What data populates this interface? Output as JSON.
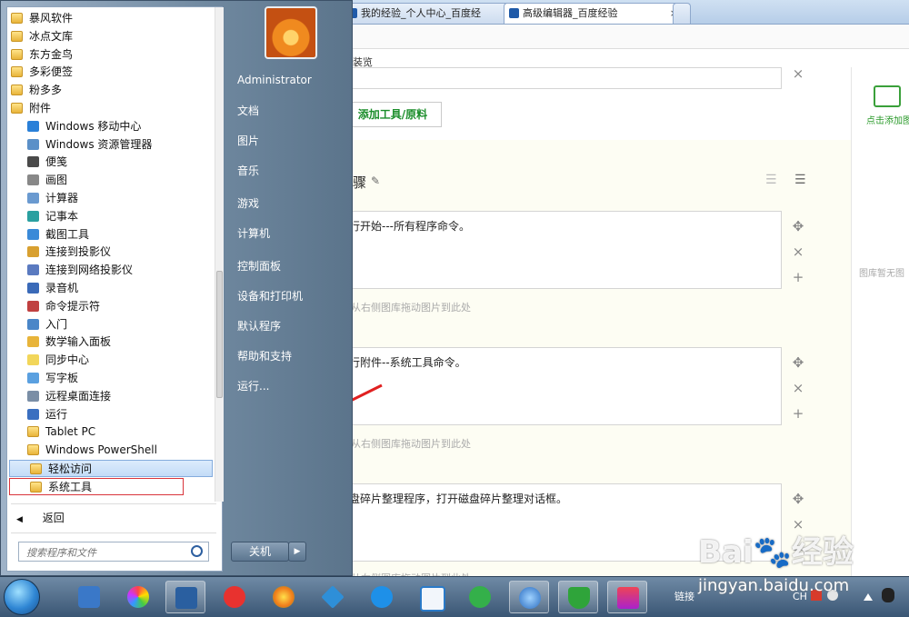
{
  "browser": {
    "tabs": [
      {
        "label": "我的经验_个人中心_百度经",
        "close": "×"
      },
      {
        "label": "高级编辑器_百度经验",
        "close": "×"
      }
    ],
    "toolbar_fragment": "装览"
  },
  "editor": {
    "material_input_placeholder": "",
    "add_tool_button": "添加工具/原料",
    "steps_heading_fragment": "骤",
    "steps": [
      {
        "text": "行开始---所有程序命令。",
        "hint": "从右侧图库拖动图片到此处"
      },
      {
        "text": "行附件--系统工具命令。",
        "hint": "从右侧图库拖动图片到此处"
      },
      {
        "text": "盘碎片整理程序，打开磁盘碎片整理对话框。",
        "hint": "从右侧图库拖动图片到此处"
      }
    ],
    "controls": {
      "move": "✥",
      "remove": "×",
      "add": "+"
    }
  },
  "gallery": {
    "add_image_label": "点击添加图",
    "empty_label": "图库暂无图"
  },
  "start_menu": {
    "programs": [
      {
        "label": "暴风软件",
        "icon": "folder",
        "indent": 0
      },
      {
        "label": "冰点文库",
        "icon": "folder",
        "indent": 0
      },
      {
        "label": "东方金鸟",
        "icon": "folder",
        "indent": 0
      },
      {
        "label": "多彩便签",
        "icon": "folder",
        "indent": 0
      },
      {
        "label": "粉多多",
        "icon": "folder",
        "indent": 0
      },
      {
        "label": "附件",
        "icon": "folder",
        "indent": 0
      },
      {
        "label": "Windows 移动中心",
        "icon": "mobility-center-icon",
        "indent": 1
      },
      {
        "label": "Windows 资源管理器",
        "icon": "explorer-icon",
        "indent": 1
      },
      {
        "label": "便笺",
        "icon": "sticky-notes-icon",
        "indent": 1
      },
      {
        "label": "画图",
        "icon": "paint-icon",
        "indent": 1
      },
      {
        "label": "计算器",
        "icon": "calculator-icon",
        "indent": 1
      },
      {
        "label": "记事本",
        "icon": "notepad-icon",
        "indent": 1
      },
      {
        "label": "截图工具",
        "icon": "snipping-tool-icon",
        "indent": 1
      },
      {
        "label": "连接到投影仪",
        "icon": "projector-icon",
        "indent": 1
      },
      {
        "label": "连接到网络投影仪",
        "icon": "network-projector-icon",
        "indent": 1
      },
      {
        "label": "录音机",
        "icon": "sound-recorder-icon",
        "indent": 1
      },
      {
        "label": "命令提示符",
        "icon": "command-prompt-icon",
        "indent": 1
      },
      {
        "label": "入门",
        "icon": "getting-started-icon",
        "indent": 1
      },
      {
        "label": "数学输入面板",
        "icon": "math-input-icon",
        "indent": 1
      },
      {
        "label": "同步中心",
        "icon": "sync-center-icon",
        "indent": 1
      },
      {
        "label": "写字板",
        "icon": "wordpad-icon",
        "indent": 1
      },
      {
        "label": "远程桌面连接",
        "icon": "remote-desktop-icon",
        "indent": 1
      },
      {
        "label": "运行",
        "icon": "run-icon",
        "indent": 1
      },
      {
        "label": "Tablet PC",
        "icon": "folder",
        "indent": 1
      },
      {
        "label": "Windows PowerShell",
        "icon": "folder",
        "indent": 1
      },
      {
        "label": "轻松访问",
        "icon": "folder",
        "indent": 1
      },
      {
        "label": "系统工具",
        "icon": "folder",
        "indent": 1
      }
    ],
    "back_label": "返回",
    "search_placeholder": "搜索程序和文件",
    "user_name": "Administrator",
    "right_links": [
      "文档",
      "图片",
      "音乐",
      "游戏",
      "计算机",
      "控制面板",
      "设备和打印机",
      "默认程序",
      "帮助和支持",
      "运行..."
    ],
    "shutdown_label": "关机"
  },
  "taskbar": {
    "tray_links": "链接",
    "tray_lang": "CH"
  },
  "watermark": {
    "brand": "Bai",
    "brand2": "经验",
    "url": "jingyan.baidu.com"
  },
  "colors": {
    "accent_green": "#1a8d2a",
    "annotation_red": "#e02020",
    "selection_blue": "#c3dcf7"
  }
}
